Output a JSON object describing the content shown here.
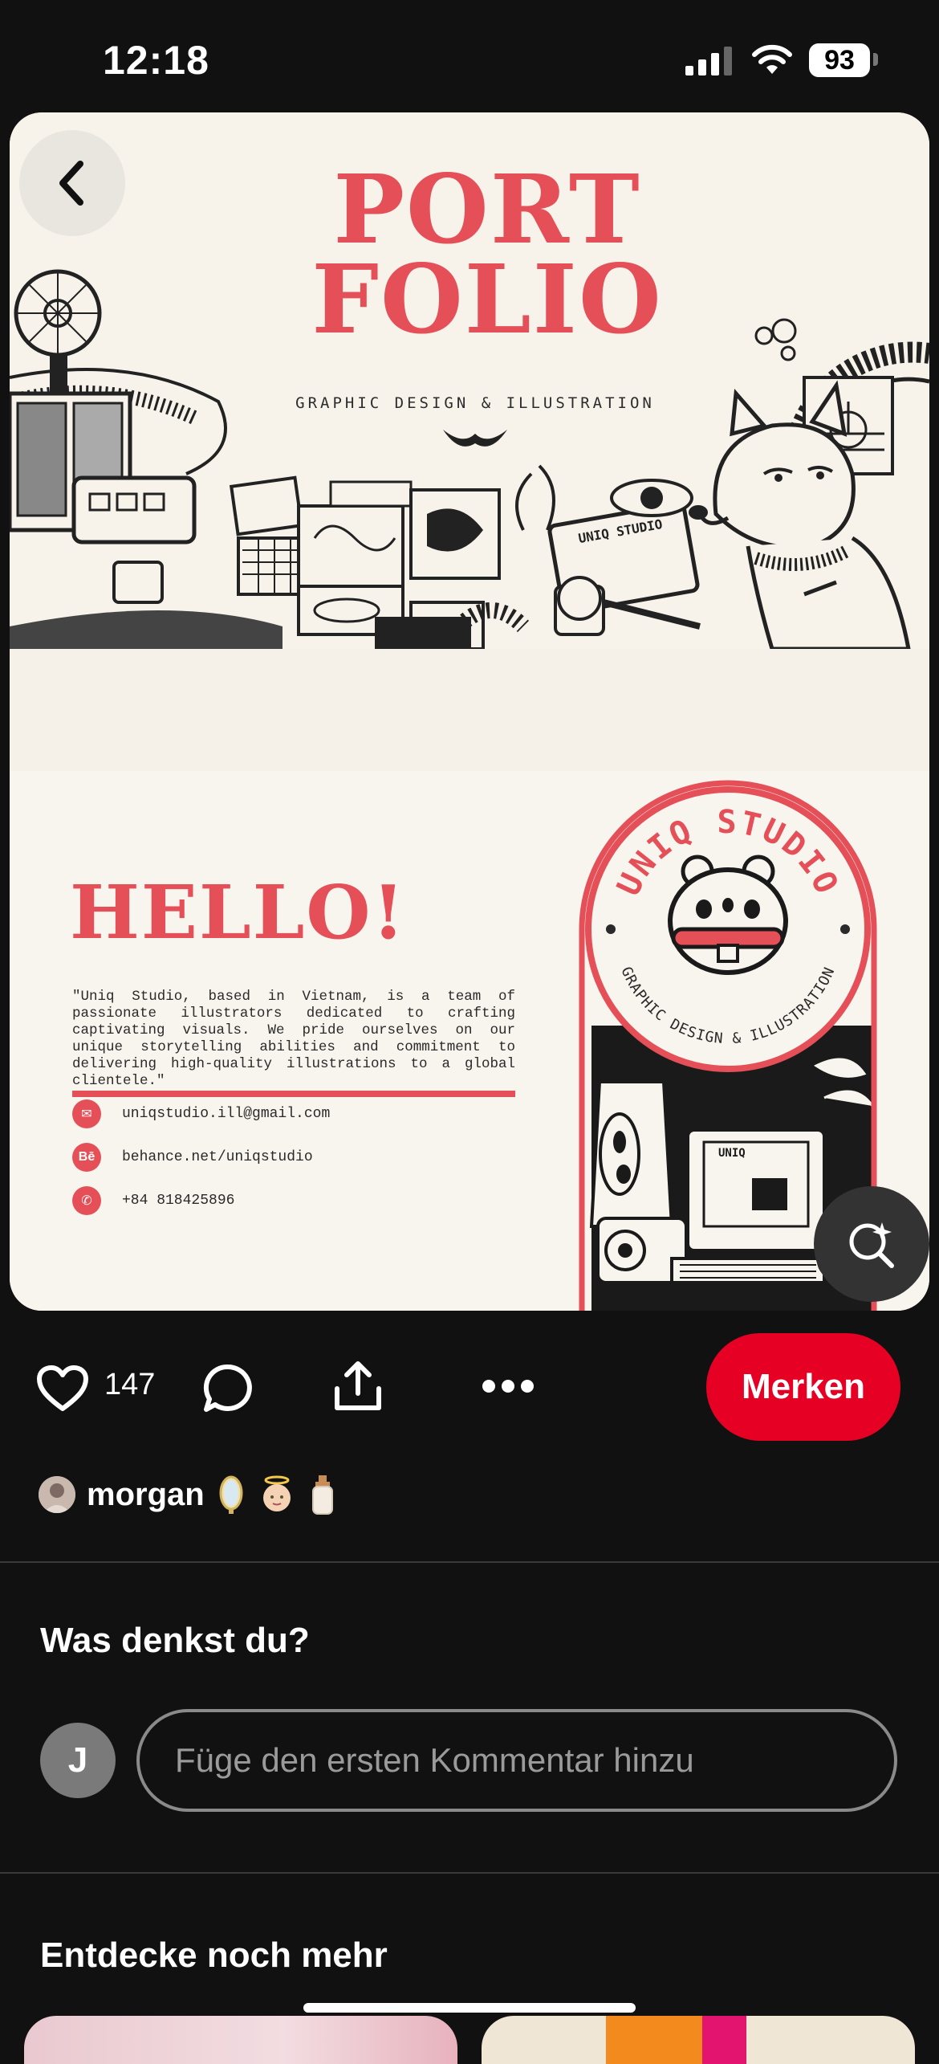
{
  "status_bar": {
    "time": "12:18",
    "battery": "93"
  },
  "pin": {
    "portfolio": {
      "title_line1": "PORT",
      "title_line2": "FOLIO",
      "subtitle": "GRAPHIC DESIGN & ILLUSTRATION",
      "laptop_label": "UNIQ STUDIO"
    },
    "hello": {
      "title": "HELLO!",
      "body": "\"Uniq Studio, based in Vietnam, is a team of passionate illustrators dedicated to crafting captivating visuals. We pride ourselves on our unique storytelling abilities and commitment to delivering high-quality illustrations to a global clientele.\"",
      "contacts": [
        {
          "icon": "mail-icon",
          "glyph": "✉",
          "text": "uniqstudio.ill@gmail.com"
        },
        {
          "icon": "behance-icon",
          "glyph": "Bē",
          "text": "behance.net/uniqstudio"
        },
        {
          "icon": "phone-icon",
          "glyph": "✆",
          "text": "+84 818425896"
        }
      ],
      "stamp_top": "UNIQ STUDIO",
      "stamp_bottom": "GRAPHIC DESIGN & ILLUSTRATION",
      "monitor_label": "UNIQ"
    }
  },
  "actions": {
    "likes": "147",
    "save_label": "Merken"
  },
  "author": {
    "name": "morgan",
    "emojis": [
      "mirror-emoji",
      "angel-emoji",
      "lotion-emoji"
    ]
  },
  "comments": {
    "heading": "Was denkst du?",
    "avatar_initial": "J",
    "placeholder": "Füge den ersten Kommentar hinzu"
  },
  "more": {
    "heading": "Entdecke noch mehr"
  },
  "colors": {
    "accent": "#e60023",
    "portfolio_red": "#e54f58",
    "background": "#111111"
  }
}
